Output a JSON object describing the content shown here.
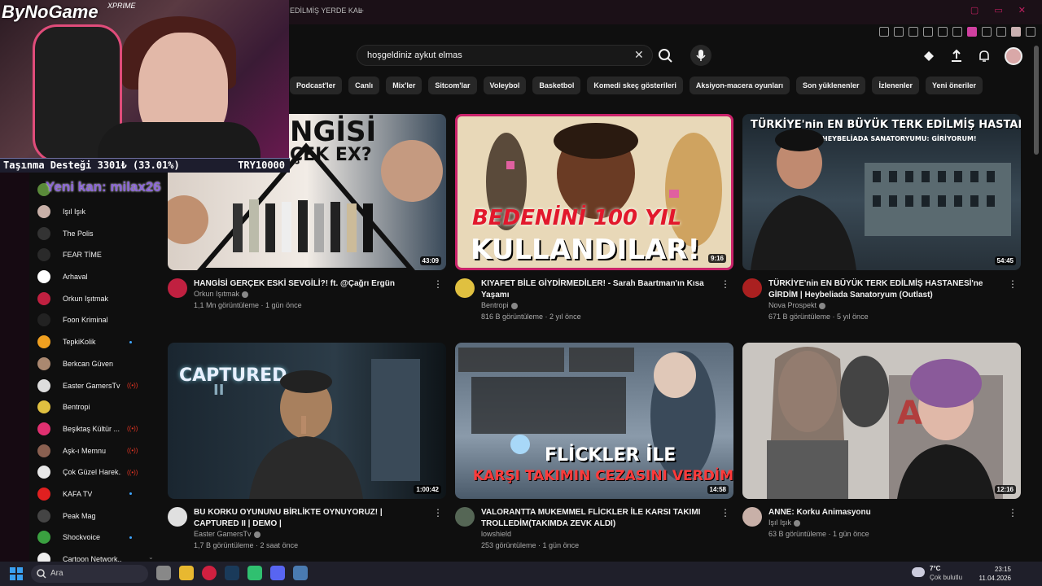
{
  "browser": {
    "tab_title": "EDİLMİŞ YERDE KAL",
    "new_tab": "+",
    "window_controls": "▢ ▭ ✕"
  },
  "search": {
    "query": "hoşgeldiniz aykut elmas",
    "clear": "✕"
  },
  "chips": [
    "Podcast'ler",
    "Canlı",
    "Mix'ler",
    "Sitcom'lar",
    "Voleybol",
    "Basketbol",
    "Komedi skeç gösterileri",
    "Aksiyon-macera oyunları",
    "Son yüklenenler",
    "İzlenenler",
    "Yeni öneriler"
  ],
  "sidebar": {
    "items": [
      {
        "label": "Işıl Işık",
        "color": "#c8b0a8"
      },
      {
        "label": "The Polis",
        "color": "#333333"
      },
      {
        "label": "FEAR TİME",
        "color": "#2a2a2a"
      },
      {
        "label": "Arhaval",
        "color": "#ffffff"
      },
      {
        "label": "Orkun Işıtmak",
        "color": "#c02040"
      },
      {
        "label": "Foon Kriminal",
        "color": "#222222"
      },
      {
        "label": "TepkiKolik",
        "color": "#f0a020"
      },
      {
        "label": "Berkcan Güven",
        "color": "#aa8870"
      },
      {
        "label": "Easter GamersTv",
        "color": "#dddddd"
      },
      {
        "label": "Bentropi",
        "color": "#e0c040"
      },
      {
        "label": "Beşiktaş Kültür ...",
        "color": "#e03070"
      },
      {
        "label": "Aşk-ı Memnu",
        "color": "#8a6050"
      },
      {
        "label": "Çok Güzel Harek...",
        "color": "#e8e8e8"
      },
      {
        "label": "KAFA TV",
        "color": "#e02020"
      },
      {
        "label": "Peak Mag",
        "color": "#444444"
      },
      {
        "label": "Shockvoice",
        "color": "#3aa040"
      },
      {
        "label": "Cartoon Network...",
        "color": "#eeeeee"
      }
    ]
  },
  "videos": [
    {
      "title": "HANGİSİ GERÇEK ESKİ SEVGİLİ?! ft. @Çağrı Ergün",
      "channel": "Orkun Işıtmak",
      "stats": "1,1 Mn görüntüleme · 1 gün önce",
      "duration": "43:09",
      "thumb_text_1": "NGİSİ",
      "thumb_text_2": "ÇEK EX?",
      "thumb_bg": "#f2ece6",
      "avatar_color": "#c02040"
    },
    {
      "title": "KIYAFET BİLE GİYDİRMEDİLER! - Sarah Baartman'ın Kısa Yaşamı",
      "channel": "Bentropi",
      "stats": "816 B görüntüleme · 2 yıl önce",
      "duration": "9:16",
      "thumb_text_1": "BEDENİNİ 100 YIL",
      "thumb_text_2": "KULLANDILAR!",
      "thumb_bg": "#e8d8b8",
      "avatar_color": "#e0c040"
    },
    {
      "title": "TÜRKİYE'nin EN BÜYÜK TERK EDİLMİŞ HASTANESİ'ne GİRDİM | Heybeliada Sanatoryum (Outlast)",
      "channel": "Nova Prospekt",
      "stats": "671 B görüntüleme · 5 yıl önce",
      "duration": "54:45",
      "thumb_text_1": "TÜRKİYE'nin EN BÜYÜK TERK EDİLMİŞ HASTANESİ",
      "thumb_text_2": "HEYBELİADA SANATORYUMU: GİRİYORUM!",
      "thumb_bg": "#2b3640",
      "avatar_color": "#aa2020"
    },
    {
      "title": "BU KORKU OYUNUNU BİRLİKTE OYNUYORUZ! | CAPTURED II | DEMO |",
      "channel": "Easter GamersTv",
      "stats": "1,7 B görüntüleme · 2 saat önce",
      "duration": "1:00:42",
      "thumb_text_1": "CAPTURED",
      "thumb_text_2": "II",
      "thumb_bg": "#1c2630",
      "avatar_color": "#e0e0e0"
    },
    {
      "title": "VALORANTTA MUKEMMEL FLİCKLER İLE KARSI TAKIMI TROLLEDİM(TAKIMDA ZEVK ALDI)",
      "channel": "lowshield",
      "stats": "253 görüntüleme · 1 gün önce",
      "duration": "14:58",
      "thumb_text_1": "FLİCKLER İLE",
      "thumb_text_2": "KARŞI TAKIMIN CEZASINI VERDİM",
      "thumb_bg": "#6a7a8a",
      "avatar_color": "#556655"
    },
    {
      "title": "ANNE: Korku Animasyonu",
      "channel": "Işıl Işık",
      "stats": "63 B görüntüleme · 1 gün önce",
      "duration": "12:16",
      "thumb_text_1": "",
      "thumb_text_2": "",
      "thumb_bg": "#c9c5c0",
      "avatar_color": "#c8b0a8"
    }
  ],
  "overlay": {
    "brand": "ByNoGame",
    "brand_sub": "XPRIME",
    "donation_left": "Taşınma Desteği 3301₺ (33.01%)",
    "donation_right": "TRY10000",
    "new_blood": "Yeni kan: milax26"
  },
  "taskbar": {
    "search_label": "Ara",
    "temp": "7°C",
    "weather_desc": "Çok bulutlu",
    "time": "23:15",
    "date": "11.04.2026"
  }
}
